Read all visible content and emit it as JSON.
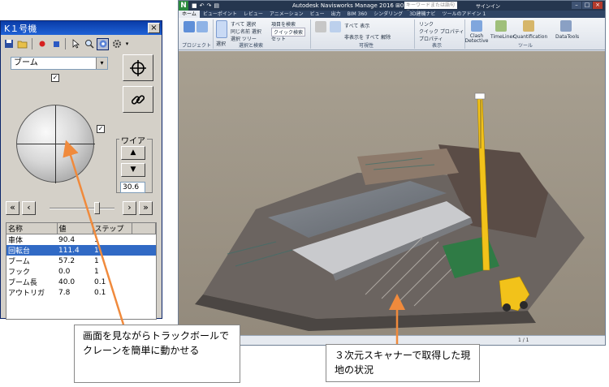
{
  "control_window": {
    "title": "K１号機",
    "close_glyph": "×",
    "toolbar": {
      "icons": [
        "save-icon",
        "open-icon",
        "record-icon",
        "stop-icon",
        "pointer-icon",
        "zoom-icon",
        "settings-icon",
        "gear-icon"
      ]
    },
    "part_select": {
      "value": "ブーム",
      "arrow": "▾"
    },
    "wire": {
      "label": "ワイア",
      "up_glyph": "▲",
      "down_glyph": "▼",
      "value": "30.6"
    },
    "nav_buttons": {
      "first": "«",
      "prev": "‹",
      "next": "›",
      "last": "»"
    },
    "table": {
      "headers": [
        "名称",
        "値",
        "ステップ"
      ],
      "rows": [
        {
          "name": "車体",
          "value": "90.4",
          "step": "1"
        },
        {
          "name": "回転台",
          "value": "111.4",
          "step": "1",
          "selected": true
        },
        {
          "name": "ブーム",
          "value": "57.2",
          "step": "1"
        },
        {
          "name": "フック",
          "value": "0.0",
          "step": "1"
        },
        {
          "name": "ブーム長",
          "value": "40.0",
          "step": "0.1"
        },
        {
          "name": "アウトリガ",
          "value": "7.8",
          "step": "0.1"
        }
      ]
    }
  },
  "navisworks": {
    "logo": "N",
    "title": "Autodesk Navisworks Manage 2016   ⊞02.nwf",
    "search_placeholder": "キーワードまたは語句を入力",
    "signin": "サインイン",
    "tabs": [
      "ホーム",
      "ビューポイント",
      "レビュー",
      "アニメーション",
      "ビュー",
      "出力",
      "BIM 360",
      "シンダリング",
      "3D建機ナビ",
      "ツールのアドイン 1"
    ],
    "active_tab": "ホーム",
    "ribbon": {
      "groups": [
        "プロジェクト",
        "選択と検索",
        "可視性",
        "表示",
        "ツール"
      ],
      "items": {
        "select": "選択",
        "select_all": "すべて 選択",
        "select_same": "同じ名前 選択",
        "select_tree": "選択 ツリー",
        "find_items": "項目を検索",
        "quick_find": "クイック検索",
        "sets": "セット",
        "show_all": "すべて 表示",
        "unhide_all": "非表示を すべて 解除",
        "links": "リンク",
        "quick_props": "クイック プロパティ",
        "properties": "プロパティ",
        "clash": "Clash Detective",
        "timeliner": "TimeLiner",
        "quantification": "Quantification",
        "datatools": "DataTools"
      }
    },
    "status": {
      "page": "1 / 1"
    }
  },
  "annotations": {
    "left": "画面を見ながらトラックボールでクレーンを簡単に動かせる",
    "right": "３次元スキャナーで取得した現地の状況"
  },
  "colors": {
    "arrow": "#f08a3c",
    "selection": "#316ac5",
    "crane_yellow": "#f2c21a"
  }
}
